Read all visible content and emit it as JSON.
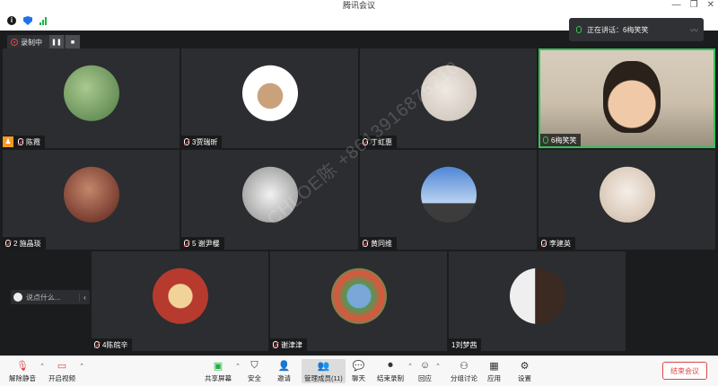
{
  "app": {
    "title": "腾讯会议"
  },
  "window_controls": [
    "—",
    "❐",
    "✕"
  ],
  "recording": {
    "label": "录制中",
    "pause": "❚❚",
    "stop": "■"
  },
  "speaker": {
    "label": "正在讲话：6梅笑笑"
  },
  "participants": [
    {
      "name": "陈霞",
      "host": true,
      "avatar_color": "#7aa36b"
    },
    {
      "name": "3贾瑞昕",
      "host": false,
      "avatar_color": "#c9a27b"
    },
    {
      "name": "丁虹惠",
      "host": false,
      "avatar_color": "#d8d2cb"
    },
    {
      "name": "6梅笑笑",
      "host": false,
      "avatar_color": "#d9c3a6",
      "speaking": true
    },
    {
      "name": "2 施晶琰",
      "host": false,
      "avatar_color": "#8b3a2a"
    },
    {
      "name": "5 谢尹樱",
      "host": false,
      "avatar_color": "#b9b9b9"
    },
    {
      "name": "黄同维",
      "host": false,
      "avatar_color": "#5f8fd1"
    },
    {
      "name": "李建英",
      "host": false,
      "avatar_color": "#e9dfd5"
    },
    {
      "name": "4陈皖辛",
      "host": false,
      "avatar_color": "#b73a2e"
    },
    {
      "name": "谢津津",
      "host": false,
      "avatar_color": "#4a9b58"
    },
    {
      "name": "1刘梦茜",
      "host": false,
      "avatar_color": "#e8e8e8"
    }
  ],
  "chat": {
    "placeholder": "说点什么..."
  },
  "watermark": "CHLOE陈 +8613916875210",
  "toolbar": {
    "mute": "解除静音",
    "video": "开启视频",
    "share": "共享屏幕",
    "security": "安全",
    "invite": "邀请",
    "members": "管理成员(11)",
    "chat": "聊天",
    "record": "结束录制",
    "react": "回应",
    "breakout": "分组讨论",
    "apps": "应用",
    "settings": "设置",
    "end": "结束会议"
  },
  "colors": {
    "accent_red": "#e04747",
    "speaking_green": "#35c15a",
    "host_orange": "#f59a23",
    "stage_bg": "#1b1c1e",
    "tile_bg": "#2b2d30"
  }
}
